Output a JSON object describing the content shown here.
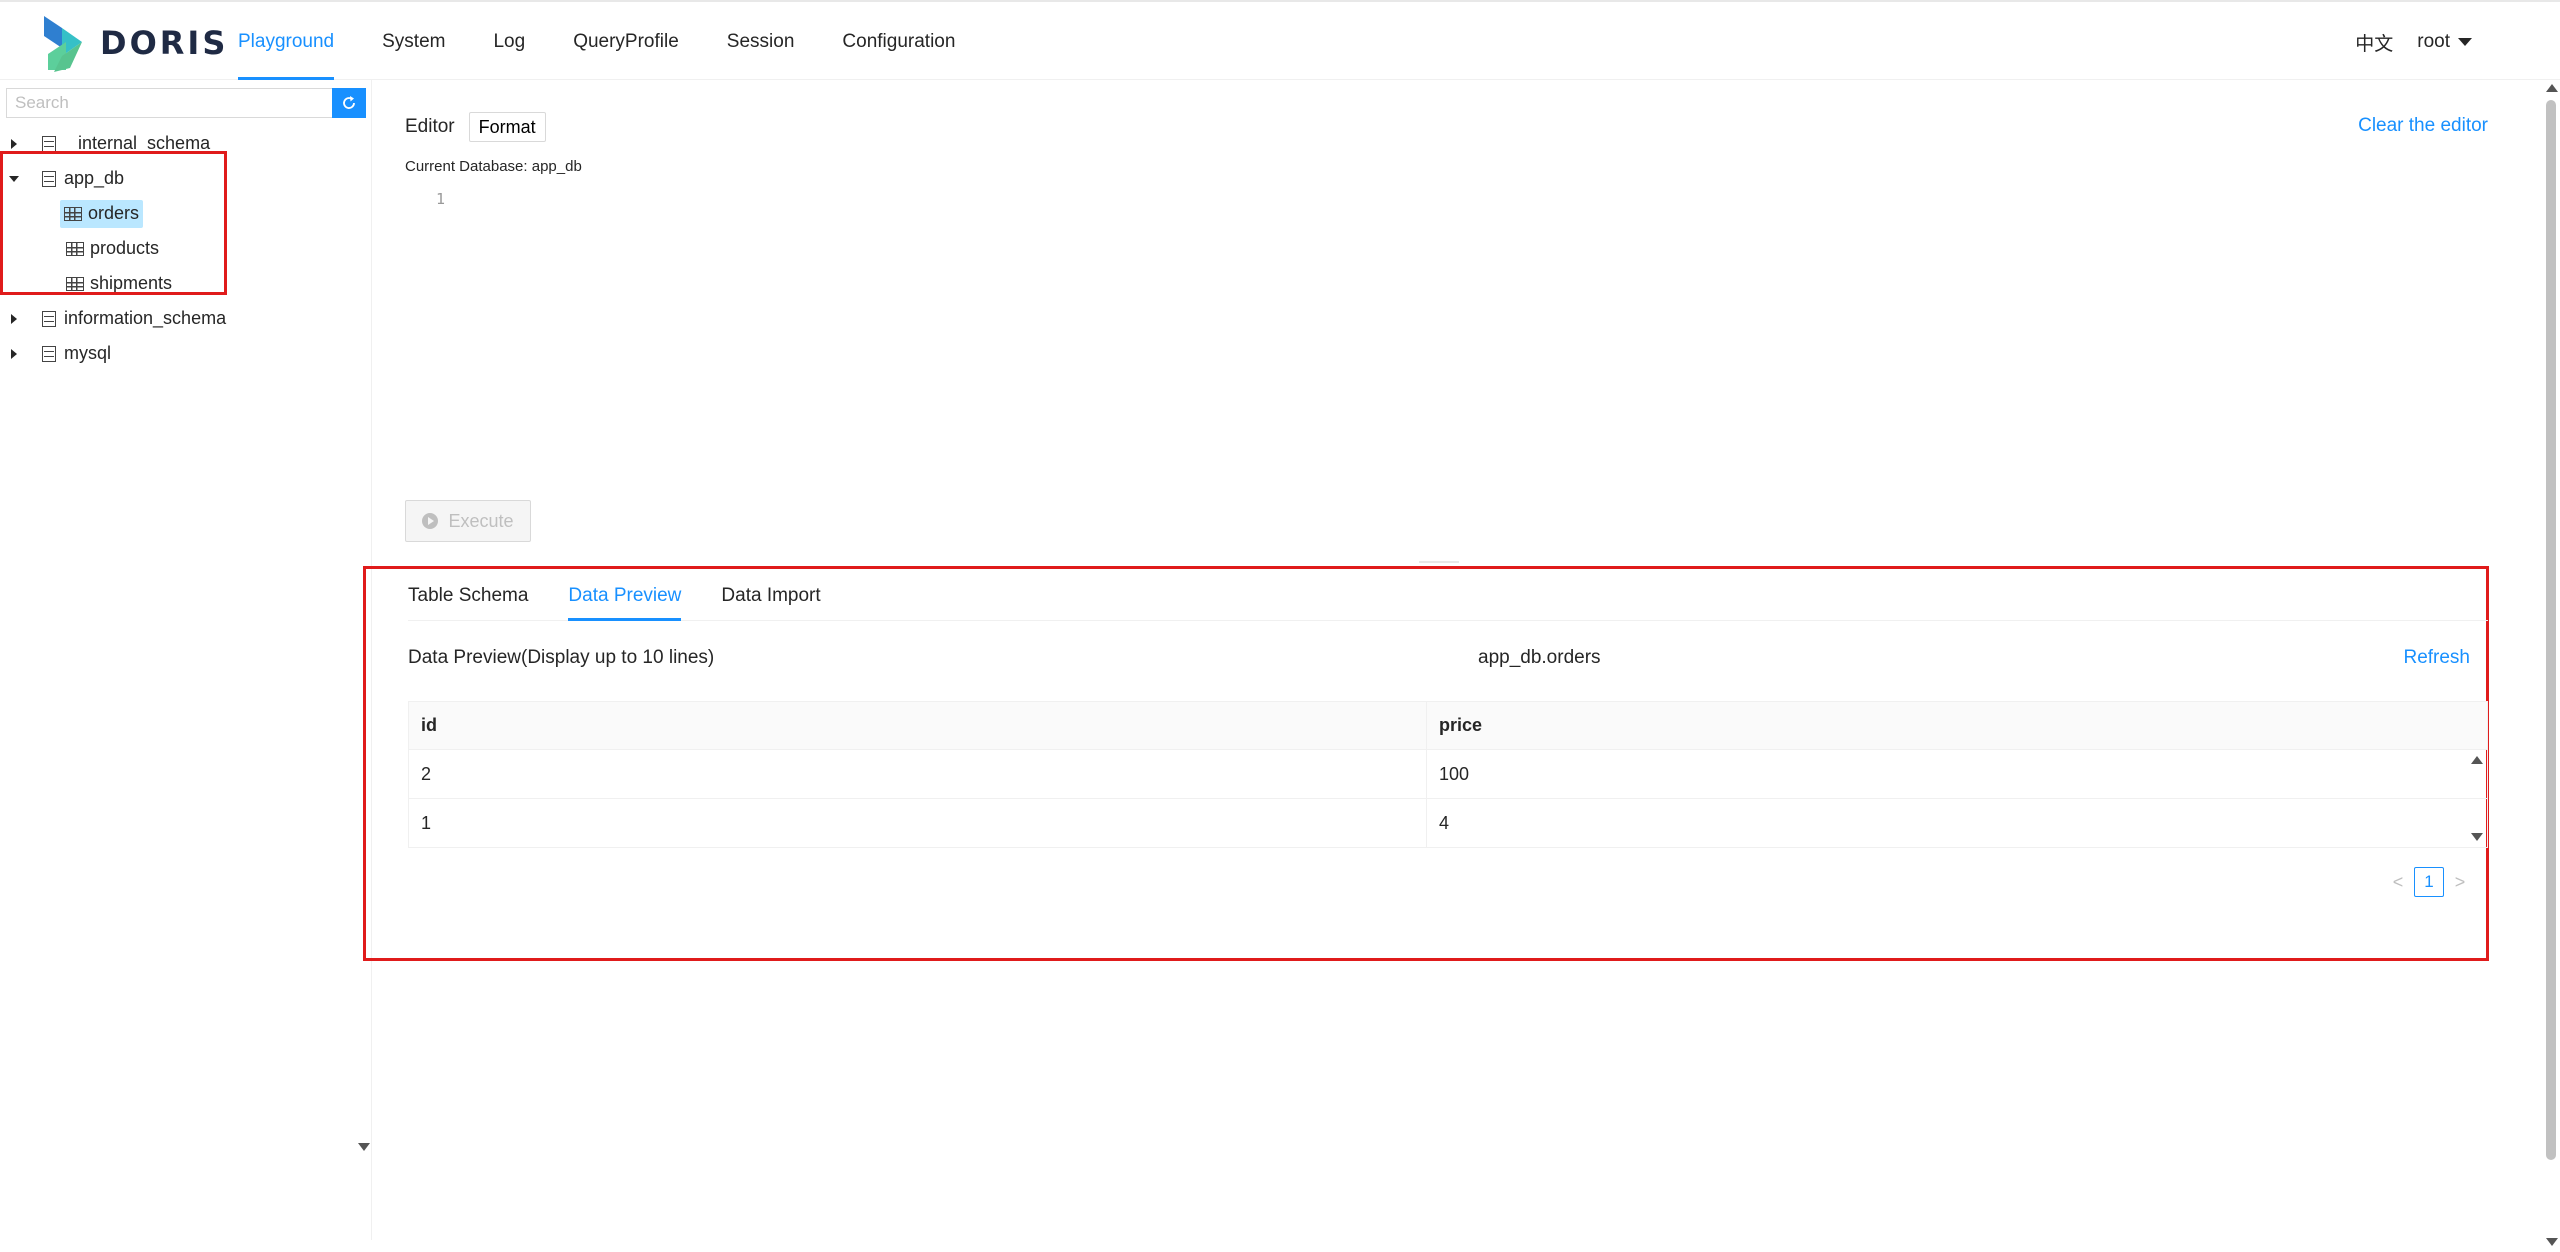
{
  "app": {
    "logo_text": "DORIS"
  },
  "nav": {
    "items": [
      {
        "label": "Playground"
      },
      {
        "label": "System"
      },
      {
        "label": "Log"
      },
      {
        "label": "QueryProfile"
      },
      {
        "label": "Session"
      },
      {
        "label": "Configuration"
      }
    ],
    "active": "Playground"
  },
  "header": {
    "lang": "中文",
    "user": "root"
  },
  "sidebar": {
    "search_placeholder": "Search",
    "tree": {
      "internal_schema": "internal_schema",
      "app_db": "app_db",
      "tables": [
        "orders",
        "products",
        "shipments"
      ],
      "information_schema": "information_schema",
      "mysql": "mysql"
    }
  },
  "editor": {
    "label": "Editor",
    "format_label": "Format",
    "clear_label": "Clear the editor",
    "current_db": "Current Database: app_db",
    "line_number": "1",
    "execute_label": "Execute"
  },
  "result": {
    "tabs": [
      "Table Schema",
      "Data Preview",
      "Data Import"
    ],
    "active_tab": "Data Preview",
    "preview_title": "Data Preview(Display up to 10 lines)",
    "table_name": "app_db.orders",
    "refresh_label": "Refresh",
    "columns": [
      "id",
      "price"
    ],
    "rows": [
      [
        "2",
        "100"
      ],
      [
        "1",
        "4"
      ]
    ],
    "page_prev": "<",
    "page_current": "1",
    "page_next": ">"
  },
  "colors": {
    "accent": "#1890ff",
    "highlight_border": "#e01b1b",
    "selected_bg": "#bae7ff"
  }
}
